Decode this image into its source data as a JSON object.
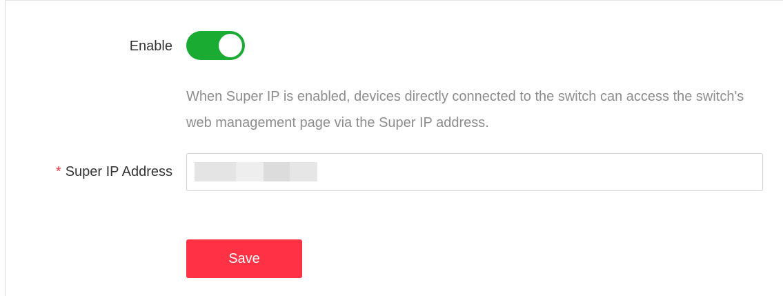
{
  "form": {
    "enable": {
      "label": "Enable",
      "toggle_on": true
    },
    "hint": "When Super IP is enabled, devices directly connected to the switch can access the switch's web management page via the Super IP address.",
    "super_ip": {
      "required_marker": "*",
      "label": "Super IP Address",
      "value": "",
      "value_masked": true
    },
    "save_label": "Save"
  },
  "colors": {
    "toggle_on": "#1aab33",
    "save_button": "#ff3144",
    "required_marker": "#ff3344",
    "hint_text": "#8c8c8c",
    "label_text": "#333333"
  }
}
